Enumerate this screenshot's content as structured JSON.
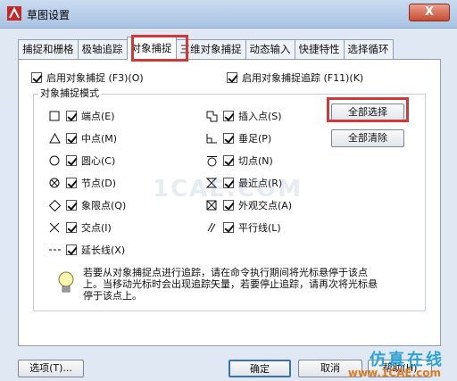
{
  "window": {
    "title": "草图设置",
    "close_label": "X"
  },
  "tabs": [
    {
      "label": "捕捉和栅格",
      "active": false
    },
    {
      "label": "极轴追踪",
      "active": false
    },
    {
      "label": "对象捕捉",
      "active": true
    },
    {
      "label": "三维对象捕捉",
      "active": false
    },
    {
      "label": "动态输入",
      "active": false
    },
    {
      "label": "快捷特性",
      "active": false
    },
    {
      "label": "选择循环",
      "active": false
    }
  ],
  "panel": {
    "enable_snap": {
      "label": "启用对象捕捉 (F3)(O)",
      "checked": true
    },
    "enable_tracking": {
      "label": "启用对象捕捉追踪  (F11)(K)",
      "checked": true
    },
    "group_title": "对象捕捉模式",
    "modes_left": [
      {
        "icon": "square-icon",
        "label": "端点(E)",
        "checked": true
      },
      {
        "icon": "triangle-icon",
        "label": "中点(M)",
        "checked": true
      },
      {
        "icon": "circle-icon",
        "label": "圆心(C)",
        "checked": true
      },
      {
        "icon": "node-icon",
        "label": "节点(D)",
        "checked": true
      },
      {
        "icon": "diamond-icon",
        "label": "象限点(Q)",
        "checked": true
      },
      {
        "icon": "x-icon",
        "label": "交点(I)",
        "checked": true
      },
      {
        "icon": "extension-icon",
        "label": "延长线(X)",
        "checked": true
      }
    ],
    "modes_right": [
      {
        "icon": "insert-icon",
        "label": "插入点(S)",
        "checked": true
      },
      {
        "icon": "perpendicular-icon",
        "label": "垂足(P)",
        "checked": true
      },
      {
        "icon": "tangent-icon",
        "label": "切点(N)",
        "checked": true
      },
      {
        "icon": "nearest-icon",
        "label": "最近点(R)",
        "checked": true
      },
      {
        "icon": "apparent-intersection-icon",
        "label": "外观交点(A)",
        "checked": true
      },
      {
        "icon": "parallel-icon",
        "label": "平行线(L)",
        "checked": true
      }
    ],
    "select_all": "全部选择",
    "clear_all": "全部清除",
    "note": "若要从对象捕捉点进行追踪，请在命令执行期间将光标悬停于该点上。当移动光标时会出现追踪矢量，若要停止追踪，请再次将光标悬停于该点上。"
  },
  "footer": {
    "options": "选项(T)...",
    "ok": "确定",
    "cancel": "取消",
    "help": "帮助(H)"
  },
  "watermark": "1CAE.COM",
  "brand": {
    "top": "仿真在线",
    "bottom": "www.1CAE.com"
  }
}
